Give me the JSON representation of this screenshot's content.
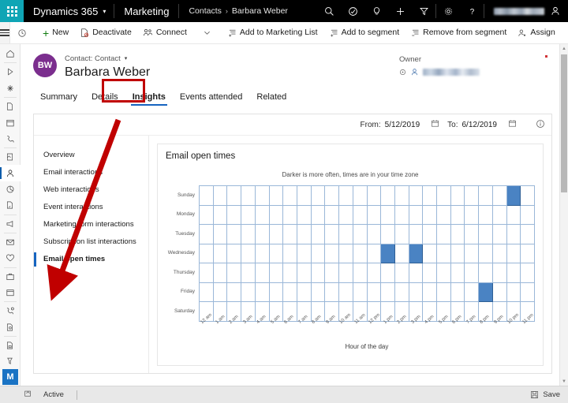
{
  "topbar": {
    "waffle_icon": "waffle-grid-icon",
    "brand": "Dynamics 365",
    "brand_chevron": "▾",
    "app_name": "Marketing",
    "breadcrumb": {
      "parent": "Contacts",
      "separator": "›",
      "current": "Barbara Weber"
    },
    "icons": [
      {
        "name": "search-icon"
      },
      {
        "name": "assistant-check-icon"
      },
      {
        "name": "lightbulb-icon"
      },
      {
        "name": "quick-create-plus-icon"
      },
      {
        "name": "filter-icon"
      },
      {
        "name": "settings-gear-icon"
      },
      {
        "name": "help-question-icon"
      }
    ],
    "user": {
      "name_redacted": true,
      "avatar_icon": "person-icon"
    }
  },
  "commandbar": {
    "menu_icon": "hamburger-menu-icon",
    "items": [
      {
        "label": "",
        "icon": "recent-clock-icon",
        "icon_only": true
      },
      {
        "label": "New",
        "icon": "plus-icon"
      },
      {
        "label": "Deactivate",
        "icon": "deactivate-icon"
      },
      {
        "label": "Connect",
        "icon": "connect-icon"
      },
      {
        "label": "",
        "icon": "chevron-down-icon",
        "icon_only": true
      },
      {
        "label": "Add to Marketing List",
        "icon": "add-to-list-icon"
      },
      {
        "label": "Add to segment",
        "icon": "add-to-segment-icon"
      },
      {
        "label": "Remove from segment",
        "icon": "remove-from-segment-icon"
      },
      {
        "label": "Assign",
        "icon": "assign-icon"
      }
    ],
    "overflow": "…"
  },
  "rail": {
    "items": [
      {
        "name": "home-icon"
      },
      {
        "name": "recent-play-icon"
      },
      {
        "name": "pinned-icon"
      },
      {
        "name": "file-icon"
      },
      {
        "name": "calendar-icon"
      },
      {
        "name": "phone-call-icon"
      },
      {
        "name": "quick-campaign-icon"
      },
      {
        "name": "contacts-person-icon",
        "selected": true
      },
      {
        "name": "analytics-pie-icon"
      },
      {
        "name": "document-icon"
      },
      {
        "name": "megaphone-icon"
      },
      {
        "name": "email-icon"
      },
      {
        "name": "heart-icon"
      },
      {
        "name": "briefcase-icon"
      },
      {
        "name": "event-calendar-icon"
      },
      {
        "name": "marketing-call-icon"
      },
      {
        "name": "file-search-icon"
      },
      {
        "name": "file-lock-icon"
      },
      {
        "name": "funnel-icon"
      },
      {
        "name": "keyboard-icon"
      }
    ],
    "badge": "M"
  },
  "contact": {
    "avatar_initials": "BW",
    "type_label": "Contact: Contact",
    "type_chevron": "▾",
    "name": "Barbara Weber",
    "owner_label": "Owner",
    "owner_lookup_icon": "lookup-icon",
    "owner_person_icon": "person-icon",
    "owner_redacted": true
  },
  "tabs": [
    {
      "label": "Summary",
      "active": false
    },
    {
      "label": "Details",
      "active": false
    },
    {
      "label": "Insights",
      "active": true,
      "highlighted": true
    },
    {
      "label": "Events attended",
      "active": false
    },
    {
      "label": "Related",
      "active": false
    }
  ],
  "daterange": {
    "from_label": "From:",
    "from_value": "5/12/2019",
    "to_label": "To:",
    "to_value": "6/12/2019",
    "calendar_icon": "calendar-icon",
    "info_icon": "info-icon"
  },
  "subnav": [
    {
      "label": "Overview",
      "selected": false
    },
    {
      "label": "Email interactions",
      "selected": false
    },
    {
      "label": "Web interactions",
      "selected": false
    },
    {
      "label": "Event interactions",
      "selected": false
    },
    {
      "label": "Marketing form interactions",
      "selected": false
    },
    {
      "label": "Subscription list interactions",
      "selected": false
    },
    {
      "label": "Email open times",
      "selected": true
    }
  ],
  "annotation": {
    "arrow_color": "#c00000",
    "highlight_color": "#c00000",
    "from": "insights-tab",
    "to": "email-open-times-subnav-item"
  },
  "statusbar": {
    "refresh_icon": "refresh-icon",
    "status": "Active",
    "save_icon": "save-disk-icon",
    "save_label": "Save"
  },
  "scrollbar": {
    "up_arrow": "▲",
    "down_arrow": "▼"
  },
  "chart_data": {
    "type": "heatmap",
    "title": "Email open times",
    "subtitle": "Darker is more often, times are in your time zone",
    "xlabel": "Hour of the day",
    "ylabel": "",
    "x_categories": [
      "12 am",
      "1 am",
      "2 am",
      "3 am",
      "4 am",
      "5 am",
      "6 am",
      "7 am",
      "8 am",
      "9 am",
      "10 am",
      "11 am",
      "12 pm",
      "1 pm",
      "2 pm",
      "3 pm",
      "4 pm",
      "5 pm",
      "6 pm",
      "7 pm",
      "8 pm",
      "9 pm",
      "10 pm",
      "11 pm"
    ],
    "y_categories": [
      "Sunday",
      "Monday",
      "Tuesday",
      "Wednesday",
      "Thursday",
      "Friday",
      "Saturday"
    ],
    "cell_on_color": "#4a83c3",
    "cell_off_color": "#ffffff",
    "grid_line_color": "#9ab7d8",
    "values": [
      [
        0,
        0,
        0,
        0,
        0,
        0,
        0,
        0,
        0,
        0,
        0,
        0,
        0,
        0,
        0,
        0,
        0,
        0,
        0,
        0,
        0,
        0,
        1,
        0
      ],
      [
        0,
        0,
        0,
        0,
        0,
        0,
        0,
        0,
        0,
        0,
        0,
        0,
        0,
        0,
        0,
        0,
        0,
        0,
        0,
        0,
        0,
        0,
        0,
        0
      ],
      [
        0,
        0,
        0,
        0,
        0,
        0,
        0,
        0,
        0,
        0,
        0,
        0,
        0,
        0,
        0,
        0,
        0,
        0,
        0,
        0,
        0,
        0,
        0,
        0
      ],
      [
        0,
        0,
        0,
        0,
        0,
        0,
        0,
        0,
        0,
        0,
        0,
        0,
        0,
        1,
        0,
        1,
        0,
        0,
        0,
        0,
        0,
        0,
        0,
        0
      ],
      [
        0,
        0,
        0,
        0,
        0,
        0,
        0,
        0,
        0,
        0,
        0,
        0,
        0,
        0,
        0,
        0,
        0,
        0,
        0,
        0,
        0,
        0,
        0,
        0
      ],
      [
        0,
        0,
        0,
        0,
        0,
        0,
        0,
        0,
        0,
        0,
        0,
        0,
        0,
        0,
        0,
        0,
        0,
        0,
        0,
        0,
        1,
        0,
        0,
        0
      ],
      [
        0,
        0,
        0,
        0,
        0,
        0,
        0,
        0,
        0,
        0,
        0,
        0,
        0,
        0,
        0,
        0,
        0,
        0,
        0,
        0,
        0,
        0,
        0,
        0
      ]
    ],
    "opens": [
      {
        "day": "Sunday",
        "hour": "10 pm"
      },
      {
        "day": "Wednesday",
        "hour": "1 pm"
      },
      {
        "day": "Wednesday",
        "hour": "3 pm"
      },
      {
        "day": "Friday",
        "hour": "8 pm"
      }
    ]
  }
}
